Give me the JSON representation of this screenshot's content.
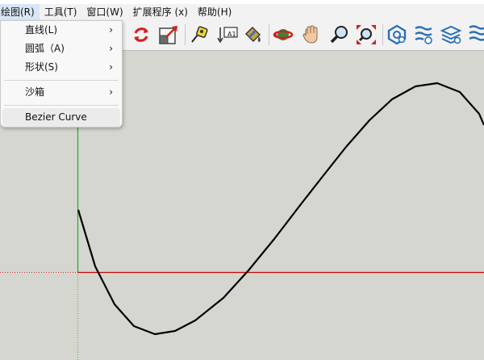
{
  "menubar": {
    "items": [
      {
        "label": "绘图(R)"
      },
      {
        "label": "工具(T)"
      },
      {
        "label": "窗口(W)"
      },
      {
        "label": "扩展程序 (x)"
      },
      {
        "label": "帮助(H)"
      }
    ]
  },
  "dropdown": {
    "items": [
      {
        "label": "直线(L)",
        "submenu": "›"
      },
      {
        "label": "圆弧（A)",
        "submenu": "›"
      },
      {
        "label": "形状(S)",
        "submenu": "›"
      },
      {
        "label": "沙箱",
        "submenu": "›"
      },
      {
        "label": "Bezier Curve"
      }
    ]
  },
  "toolbar": {
    "icons": [
      "rotate-icon",
      "scale-icon",
      "tape-measure-icon",
      "text-tool-icon",
      "paint-bucket-icon",
      "orbit-icon",
      "pan-hand-icon",
      "zoom-icon",
      "zoom-extents-icon",
      "extension-1-icon",
      "extension-2-icon",
      "extension-3-icon",
      "extension-4-icon"
    ],
    "text_tool_glyph": "A1"
  },
  "colors": {
    "red_axis": "#cc0000",
    "green_axis": "#22aa22",
    "curve": "#000000",
    "viewport_bg": "#d6d6d0"
  }
}
